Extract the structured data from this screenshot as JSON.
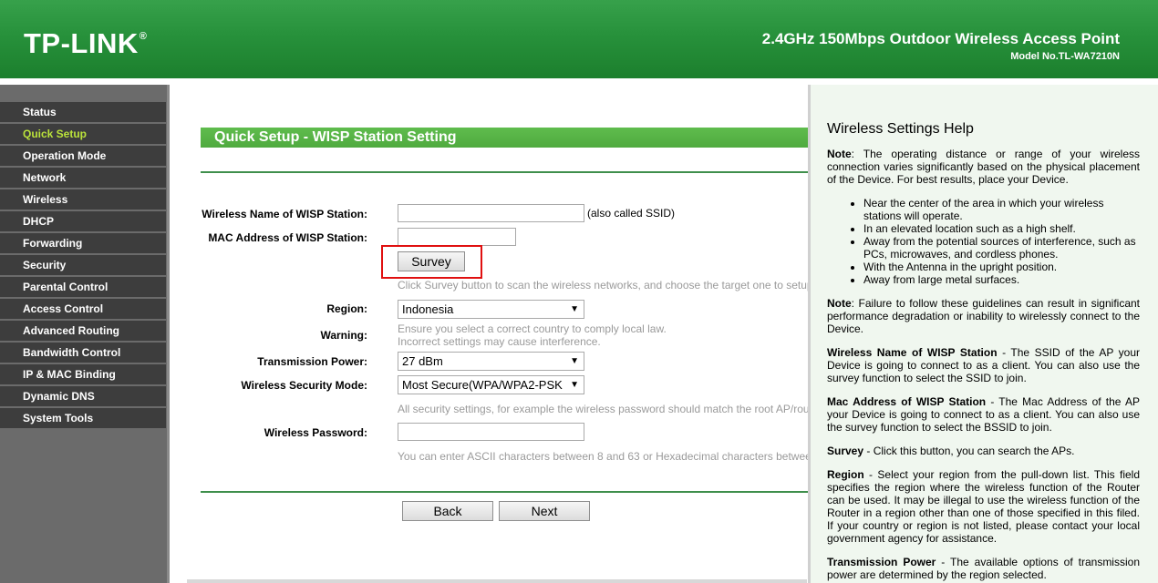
{
  "header": {
    "logo": "TP-LINK",
    "logo_mark": "®",
    "product": "2.4GHz 150Mbps Outdoor Wireless Access Point",
    "model": "Model No.TL-WA7210N"
  },
  "sidebar": {
    "items": [
      {
        "label": "Status"
      },
      {
        "label": "Quick Setup"
      },
      {
        "label": "Operation Mode"
      },
      {
        "label": "Network"
      },
      {
        "label": "Wireless"
      },
      {
        "label": "DHCP"
      },
      {
        "label": "Forwarding"
      },
      {
        "label": "Security"
      },
      {
        "label": "Parental Control"
      },
      {
        "label": "Access Control"
      },
      {
        "label": "Advanced Routing"
      },
      {
        "label": "Bandwidth Control"
      },
      {
        "label": "IP & MAC Binding"
      },
      {
        "label": "Dynamic DNS"
      },
      {
        "label": "System Tools"
      }
    ],
    "active": "Quick Setup"
  },
  "main": {
    "title": "Quick Setup - WISP Station Setting",
    "ssid_label": "Wireless Name of WISP Station:",
    "ssid_value": "",
    "ssid_note": "(also called SSID)",
    "mac_label": "MAC Address of WISP Station:",
    "mac_value": "",
    "survey_button": "Survey",
    "survey_hint": "Click Survey button to scan the wireless networks, and choose the target one to setup",
    "region_label": "Region:",
    "region_value": "Indonesia",
    "warning_label": "Warning:",
    "warning_line1": "Ensure you select a correct country to comply local law.",
    "warning_line2": "Incorrect settings may cause interference.",
    "power_label": "Transmission Power:",
    "power_value": "27 dBm",
    "security_label": "Wireless Security Mode:",
    "security_value": "Most Secure(WPA/WPA2-PSK",
    "security_hint": "All security settings, for example the wireless password should match the root AP/router",
    "password_label": "Wireless Password:",
    "password_value": "",
    "password_hint": "You can enter ASCII characters between 8 and 63 or Hexadecimal characters between",
    "back_button": "Back",
    "next_button": "Next"
  },
  "help": {
    "title": "Wireless Settings Help",
    "note1_label": "Note",
    "note1_text": ": The operating distance or range of your wireless connection varies significantly based on the physical placement of the Device. For best results, place your Device.",
    "bullets": [
      "Near the center of the area in which your wireless stations will operate.",
      "In an elevated location such as a high shelf.",
      "Away from the potential sources of interference, such as PCs, microwaves, and cordless phones.",
      "With the Antenna in the upright position.",
      "Away from large metal surfaces."
    ],
    "note2_label": "Note",
    "note2_text": ": Failure to follow these guidelines can result in significant performance degradation or inability to wirelessly connect to the Device.",
    "p_ssid_label": "Wireless Name of WISP Station",
    "p_ssid_text": " - The SSID of the AP your Device is going to connect to as a client. You can also use the survey function to select the SSID to join.",
    "p_mac_label": "Mac Address of WISP Station",
    "p_mac_text": " - The Mac Address of the AP your Device is going to connect to as a client. You can also use the survey function to select the BSSID to join.",
    "p_survey_label": "Survey",
    "p_survey_text": " - Click this button, you can search the APs.",
    "p_region_label": "Region",
    "p_region_text": " - Select your region from the pull-down list. This field specifies the region where the wireless function of the Router can be used. It may be illegal to use the wireless function of the Router in a region other than one of those specified in this filed. If your country or region is not listed, please contact your local government agency for assistance.",
    "p_power_label": "Transmission Power",
    "p_power_text": " - The available options of transmission power are determined by the region selected."
  }
}
